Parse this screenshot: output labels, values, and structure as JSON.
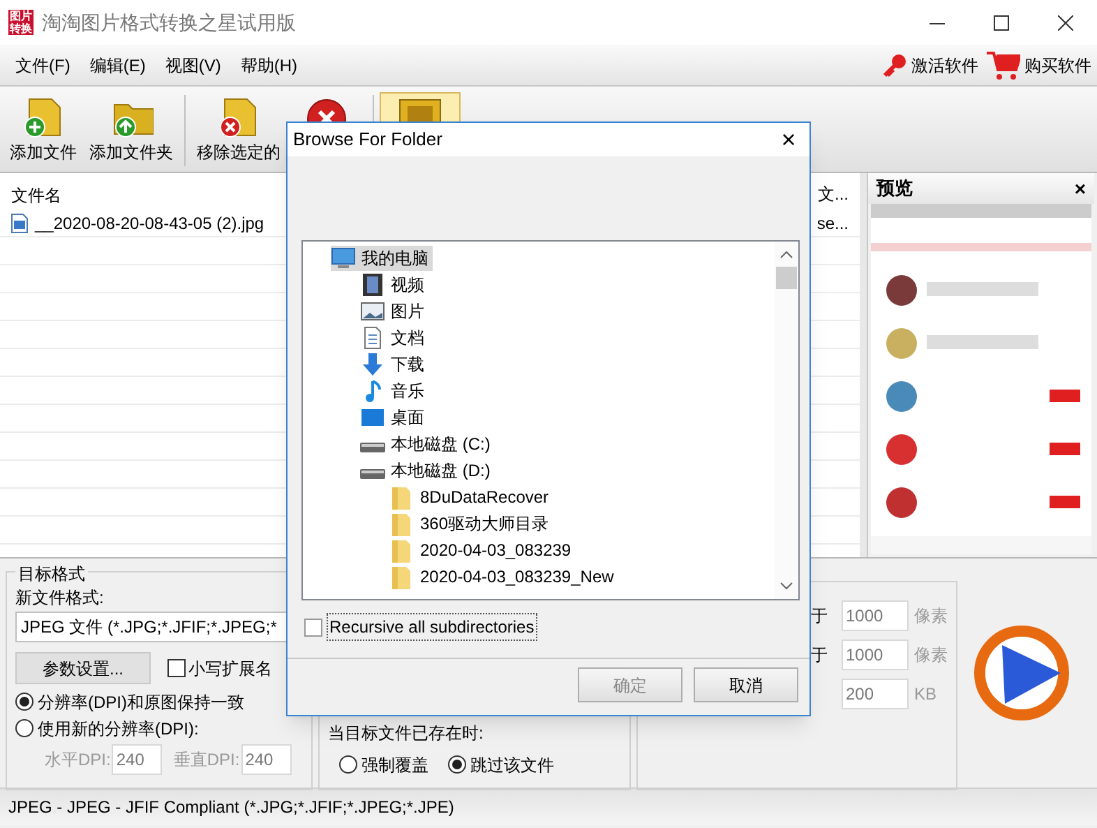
{
  "window": {
    "title": "淘淘图片格式转换之星试用版",
    "logo": "图片转换"
  },
  "menu": [
    "文件(F)",
    "编辑(E)",
    "视图(V)",
    "帮助(H)"
  ],
  "menu_right": [
    {
      "kind": "key",
      "label": "激活软件"
    },
    {
      "kind": "cart",
      "label": "购买软件"
    }
  ],
  "toolbar": [
    {
      "kind": "add-file",
      "label": "添加文件",
      "selected": false
    },
    {
      "kind": "add-folder",
      "label": "添加文件夹",
      "selected": false
    },
    {
      "kind": "remove",
      "label": "移除选定的",
      "selected": false
    },
    {
      "kind": "clear",
      "selected": false
    },
    {
      "kind": "preview",
      "selected": true
    }
  ],
  "file_list": {
    "columns": [
      "文件名",
      "文..."
    ],
    "rows": [
      [
        "__2020-08-20-08-43-05 (2).jpg",
        "se..."
      ]
    ]
  },
  "preview": {
    "title": "预览",
    "close": "×"
  },
  "settings": {
    "group_title": "目标格式",
    "format_label": "新文件格式:",
    "format_value": "JPEG 文件 (*.JPG;*.JFIF;*.JPEG;*",
    "params_button": "参数设置...",
    "lowercase": {
      "label": "小写扩展名",
      "checked": false
    },
    "dpi_options": [
      {
        "label": "分辨率(DPI)和原图保持一致",
        "selected": true
      },
      {
        "label": "使用新的分辨率(DPI):",
        "selected": false
      }
    ],
    "dpi_fields": [
      {
        "label": "水平DPI:",
        "value": "240"
      },
      {
        "label": "垂直DPI:",
        "value": "240"
      }
    ],
    "exists_label": "当目标文件已存在时:",
    "exists_options": [
      {
        "label": "强制覆盖",
        "selected": false
      },
      {
        "label": "跳过该文件",
        "selected": true
      }
    ],
    "limits": [
      {
        "label": "于",
        "value": "1000",
        "unit": "像素"
      },
      {
        "label": "于",
        "value": "1000",
        "unit": "像素"
      },
      {
        "value": "200",
        "unit": "KB"
      }
    ]
  },
  "status_bar": "JPEG - JPEG - JFIF Compliant (*.JPG;*.JFIF;*.JPEG;*.JPE)",
  "dialog": {
    "title": "Browse For Folder",
    "close": "×",
    "tree": [
      {
        "kind": "computer",
        "label": "我的电脑",
        "selected": true,
        "children": [
          {
            "kind": "video",
            "label": "视频",
            "selected": false
          },
          {
            "kind": "picture",
            "label": "图片",
            "selected": false
          },
          {
            "kind": "document",
            "label": "文档",
            "selected": false
          },
          {
            "kind": "download",
            "label": "下载",
            "selected": false
          },
          {
            "kind": "music",
            "label": "音乐",
            "selected": false
          },
          {
            "kind": "desktop",
            "label": "桌面",
            "selected": false
          },
          {
            "kind": "drive",
            "label": "本地磁盘 (C:)",
            "selected": false
          },
          {
            "kind": "drive",
            "label": "本地磁盘 (D:)",
            "selected": false,
            "children": [
              {
                "kind": "folder",
                "label": "8DuDataRecover",
                "selected": false
              },
              {
                "kind": "folder",
                "label": "360驱动大师目录",
                "selected": false
              },
              {
                "kind": "folder",
                "label": "2020-04-03_083239",
                "selected": false
              },
              {
                "kind": "folder",
                "label": "2020-04-03_083239_New",
                "selected": false
              }
            ]
          }
        ]
      }
    ],
    "recursive": {
      "label": "Recursive all subdirectories",
      "checked": false
    },
    "buttons": [
      {
        "label": "确定",
        "disabled": true
      },
      {
        "label": "取消",
        "disabled": false
      }
    ]
  }
}
